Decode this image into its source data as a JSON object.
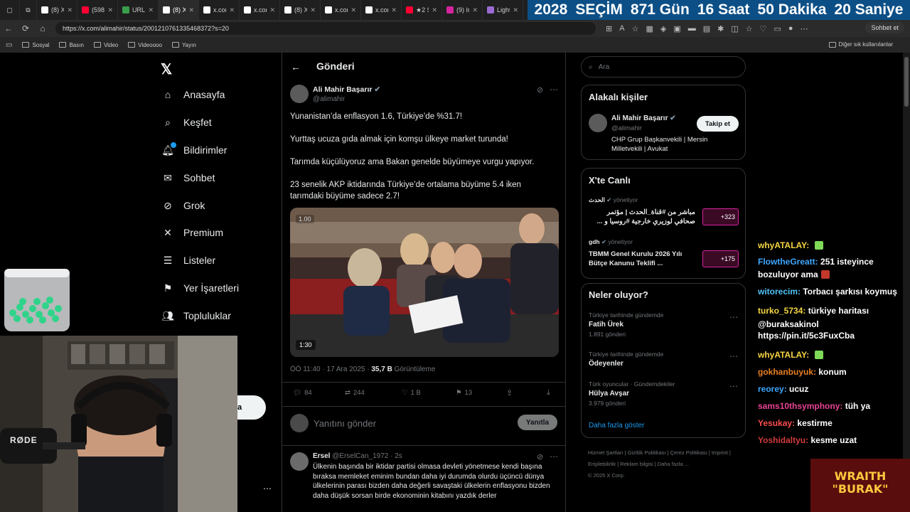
{
  "tabs": [
    {
      "label": "(8) X",
      "color": "#ffffff"
    },
    {
      "label": "(598)",
      "color": "#ff0033"
    },
    {
      "label": "URL",
      "color": "#3a9d4c"
    },
    {
      "label": "(8) X",
      "color": "#ffffff"
    },
    {
      "label": "x.com",
      "color": "#ffffff"
    },
    {
      "label": "x.com",
      "color": "#ffffff"
    },
    {
      "label": "(8) X",
      "color": "#ffffff"
    },
    {
      "label": "x.com",
      "color": "#ffffff"
    },
    {
      "label": "x.com",
      "color": "#ffffff"
    },
    {
      "label": "★2 S",
      "color": "#ff0033"
    },
    {
      "label": "(9) In",
      "color": "#d6249f"
    },
    {
      "label": "Light",
      "color": "#9b6bd3"
    }
  ],
  "countdown": [
    "2028",
    "SEÇİM",
    "871 Gün",
    "16 Saat",
    "50 Dakika",
    "20 Saniye"
  ],
  "address": {
    "url": "https://x.com/alimahir/status/2001210761335468372?s=20",
    "sohbet_label": "Sohbet et"
  },
  "bookmarks": [
    "Sosyal",
    "Basın",
    "Video",
    "Videoooo",
    "Yayın"
  ],
  "bookmarks_right": "Diğer sık kullanılanlar",
  "nav": {
    "items": [
      "Anasayfa",
      "Keşfet",
      "Bildirimler",
      "Sohbet",
      "Grok",
      "Premium",
      "Listeler",
      "Yer İşaretleri",
      "Topluluklar"
    ],
    "post_button_fragment": "a"
  },
  "header": {
    "title": "Gönderi"
  },
  "tweet": {
    "author": "Ali Mahir Başarır",
    "handle": "@alimahir",
    "paragraphs": [
      "Yunanistan’da enflasyon 1.6, Türkiye’de %31.7!",
      "Yurttaş ucuza gıda almak için komşu ülkeye market turunda!",
      "Tarımda küçülüyoruz ama Bakan genelde büyümeye vurgu yapıyor.",
      "23 senelik AKP iktidarında Türkiye’de ortalama büyüme 5.4 iken tarımdaki büyüme sadece 2.7!"
    ],
    "video_speed": "1.00",
    "video_duration": "1:30",
    "timestamp": "ÖÖ 11:40 · 17 Ara 2025 · ",
    "views_count": "35,7 B",
    "views_label": " Görüntüleme",
    "actions": {
      "replies": "84",
      "reposts": "244",
      "likes": "1 B",
      "bookmarks": "13"
    },
    "reply_placeholder": "Yanıtını gönder",
    "reply_button": "Yanıtla"
  },
  "reply": {
    "author": "Ersel",
    "handle": "@ErselCan_1972 · 2s",
    "text": "Ülkenin başında bir iktidar partisi olmasa devleti yönetmese kendi başına bıraksa memleket eminim bundan daha iyi durumda olurdu üçüncü dünya ülkelerinin parası bizden daha değerli  savaştaki ülkelerin enflasyonu bizden daha düşük sorsan birde ekonominin kitabını yazdık derler"
  },
  "search": {
    "placeholder": "Ara"
  },
  "related": {
    "title": "Alakalı kişiler",
    "name": "Ali Mahir Başarır",
    "handle": "@alimahir",
    "bio": "CHP Grup Başkanvekili | Mersin Milletvekili | Avukat",
    "follow_label": "Takip et"
  },
  "live": {
    "title": "X'te Canlı",
    "items": [
      {
        "host": "الحدث",
        "role": "yönetiyor",
        "text": "مباشر من #قناة_الحدث | مؤتمر صحافي لوزيري خارجية #روسيا و ...",
        "count": "+323"
      },
      {
        "host": "gdh",
        "role": "yönetiyor",
        "text": "TBMM Genel Kurulu 2026 Yılı Bütçe Kanunu Teklifi ...",
        "count": "+175"
      }
    ]
  },
  "trends": {
    "title": "Neler oluyor?",
    "items": [
      {
        "category": "Türkiye tarihinde gündemde",
        "name": "Fatih Ürek",
        "count": "1.891 gönderi"
      },
      {
        "category": "Türkiye tarihinde gündemde",
        "name": "Ödeyenler",
        "count": ""
      },
      {
        "category": "Türk oyuncular · Gündemdekiler",
        "name": "Hülya Avşar",
        "count": "3.979 gönderi"
      }
    ],
    "show_more": "Daha fazla göster"
  },
  "footer": {
    "links": [
      "Hizmet Şartları",
      "Gizlilik Politikası",
      "Çerez Politikası",
      "Imprint",
      "Erişilebilirlik",
      "Reklam bilgisi",
      "Daha fazla ..."
    ],
    "copyright": "© 2025 X Corp."
  },
  "chat": [
    {
      "user": "whyATALAY:",
      "color": "#f5d442",
      "msg": "",
      "emote": "#7ed957"
    },
    {
      "user": "FlowtheGreatt:",
      "color": "#3fa7ff",
      "msg": "251 isteyince",
      "emote": ""
    },
    {
      "user": "",
      "color": "#ffffff",
      "msg": "bozuluyor ama",
      "emote": "#c0392b"
    },
    {
      "user": "witorecim:",
      "color": "#4fc3f7",
      "msg": "Torbacı şarkısı koymuş",
      "emote": ""
    },
    {
      "user": "turko_5734:",
      "color": "#f5d442",
      "msg": "türkiye haritası",
      "emote": ""
    },
    {
      "user": "",
      "color": "#ffffff",
      "msg": "@buraksakinol",
      "emote": ""
    },
    {
      "user": "",
      "color": "#ffffff",
      "msg": "https://pin.it/5c3FuxCba",
      "emote": ""
    },
    {
      "user": "whyATALAY:",
      "color": "#f5d442",
      "msg": "",
      "emote": "#7ed957"
    },
    {
      "user": "gokhanbuyuk:",
      "color": "#e67e22",
      "msg": "konum",
      "emote": ""
    },
    {
      "user": "reorey:",
      "color": "#3fa7ff",
      "msg": "ucuz",
      "emote": ""
    },
    {
      "user": "sams10thsymphony:",
      "color": "#e84393",
      "msg": "tüh ya",
      "emote": ""
    },
    {
      "user": "Yesukay:",
      "color": "#ff4d4d",
      "msg": "kestirme",
      "emote": ""
    },
    {
      "user": "Yoshidaltyu:",
      "color": "#d13b3b",
      "msg": "kesme uzat",
      "emote": ""
    }
  ],
  "overlay": {
    "brand_line1": "WRAITH",
    "brand_line2": "\"BURAK\"",
    "mic_label": "RØDE"
  }
}
